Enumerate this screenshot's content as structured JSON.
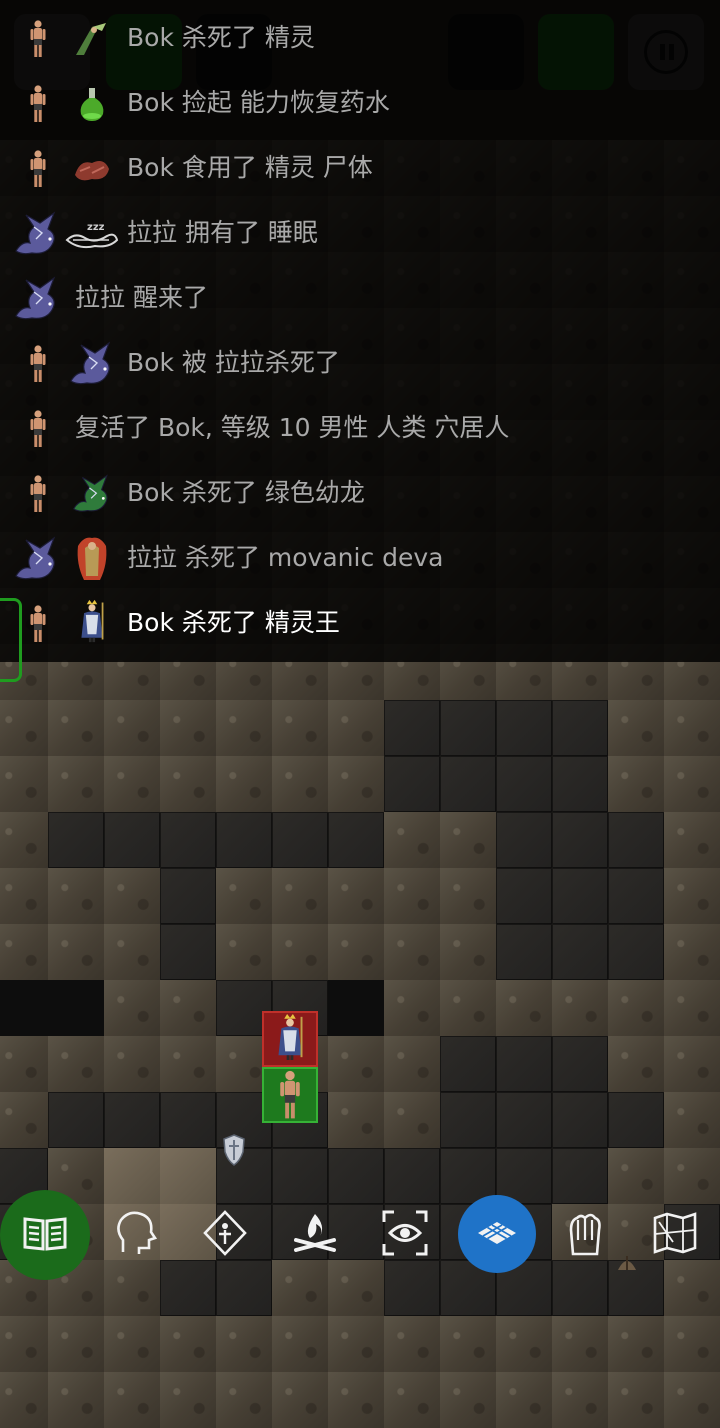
{
  "log": {
    "entries": [
      {
        "text": "Bok 杀死了 精灵",
        "icons": [
          "human-sprite-icon",
          "elf-sprite-icon"
        ]
      },
      {
        "text": "Bok 捡起 能力恢复药水",
        "icons": [
          "human-sprite-icon",
          "potion-icon"
        ]
      },
      {
        "text": "Bok 食用了 精灵 尸体",
        "icons": [
          "human-sprite-icon",
          "corpse-icon"
        ]
      },
      {
        "text": "拉拉 拥有了 睡眠",
        "icons": [
          "dragon-sprite-icon",
          "sleep-icon"
        ]
      },
      {
        "text": "拉拉 醒来了",
        "icons": [
          "dragon-sprite-icon"
        ]
      },
      {
        "text": "Bok 被 拉拉杀死了",
        "icons": [
          "human-sprite-icon",
          "dragon-sprite-icon"
        ]
      },
      {
        "text": "复活了 Bok, 等级 10 男性 人类 穴居人",
        "icons": [
          "human-sprite-icon"
        ]
      },
      {
        "text": "Bok 杀死了 绿色幼龙",
        "icons": [
          "human-sprite-icon",
          "green-dragon-icon"
        ]
      },
      {
        "text": "拉拉 杀死了 movanic deva",
        "icons": [
          "dragon-sprite-icon",
          "deva-icon"
        ]
      },
      {
        "text": "Bok 杀死了 精灵王",
        "icons": [
          "human-sprite-icon",
          "elf-king-icon"
        ]
      }
    ]
  },
  "colors": {
    "log_text": "#a9a9a9",
    "latest_text": "#ffffff",
    "accent_green": "#1b6b1b",
    "accent_blue": "#1f73c8",
    "enemy_tile": "#8b1a1a",
    "player_tile": "#1e7a1e"
  },
  "action_bar": {
    "items": [
      {
        "name": "journal",
        "icon": "book-icon",
        "active": true
      },
      {
        "name": "talk",
        "icon": "head-icon",
        "active": false
      },
      {
        "name": "abilities",
        "icon": "magic-icon",
        "active": false
      },
      {
        "name": "rest",
        "icon": "campfire-icon",
        "active": false
      },
      {
        "name": "look",
        "icon": "eye-icon",
        "active": false
      },
      {
        "name": "map-grid",
        "icon": "grid-icon",
        "active": true
      },
      {
        "name": "inventory",
        "icon": "gloves-icon",
        "active": false
      },
      {
        "name": "world-map",
        "icon": "map-icon",
        "active": false
      }
    ]
  }
}
